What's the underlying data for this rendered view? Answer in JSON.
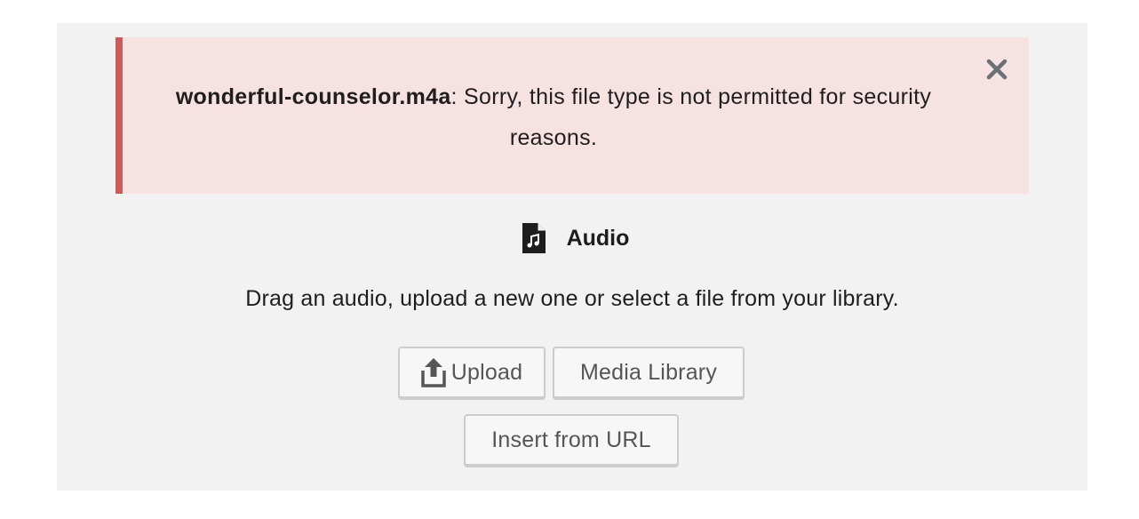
{
  "notice": {
    "filename": "wonderful-counselor.m4a",
    "message": ": Sorry, this file type is not permitted for security reasons.",
    "close_icon": "close-icon",
    "colors": {
      "background": "#f5e2e1",
      "border": "#cc5c57"
    }
  },
  "placeholder": {
    "icon": "audio-file-icon",
    "label": "Audio",
    "instructions": "Drag an audio, upload a new one or select a file from your library."
  },
  "buttons": {
    "upload_icon": "upload-icon",
    "upload": "Upload",
    "media_library": "Media Library",
    "insert_url": "Insert from URL"
  }
}
